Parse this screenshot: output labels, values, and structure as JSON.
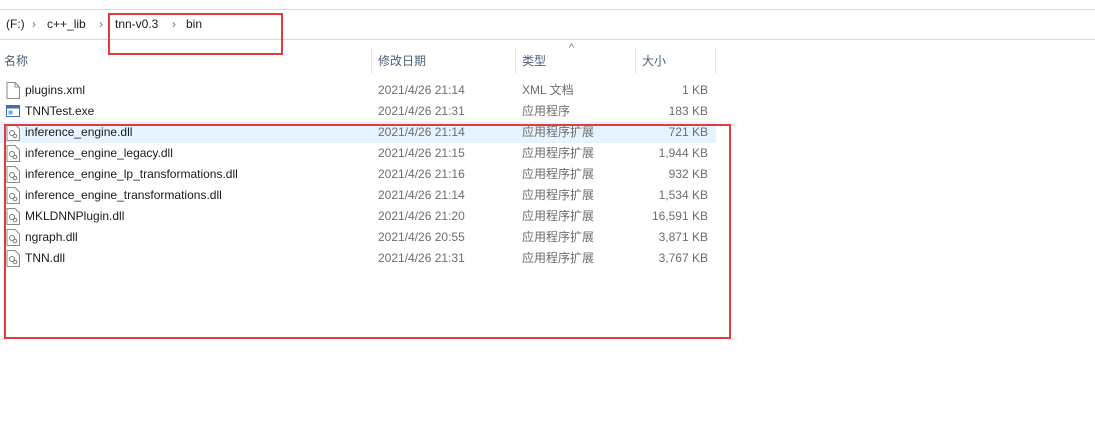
{
  "breadcrumb": {
    "items": [
      "(F:)",
      "c++_lib",
      "tnn-v0.3",
      "bin"
    ],
    "separator": ">"
  },
  "columns": {
    "name": "名称",
    "date": "修改日期",
    "type": "类型",
    "size": "大小"
  },
  "files": [
    {
      "name": "plugins.xml",
      "date": "2021/4/26 21:14",
      "type": "XML 文档",
      "size": "1 KB",
      "icon": "xml-file-icon"
    },
    {
      "name": "TNNTest.exe",
      "date": "2021/4/26 21:31",
      "type": "应用程序",
      "size": "183 KB",
      "icon": "exe-file-icon"
    },
    {
      "name": "inference_engine.dll",
      "date": "2021/4/26 21:14",
      "type": "应用程序扩展",
      "size": "721 KB",
      "icon": "dll-file-icon"
    },
    {
      "name": "inference_engine_legacy.dll",
      "date": "2021/4/26 21:15",
      "type": "应用程序扩展",
      "size": "1,944 KB",
      "icon": "dll-file-icon"
    },
    {
      "name": "inference_engine_lp_transformations.dll",
      "date": "2021/4/26 21:16",
      "type": "应用程序扩展",
      "size": "932 KB",
      "icon": "dll-file-icon"
    },
    {
      "name": "inference_engine_transformations.dll",
      "date": "2021/4/26 21:14",
      "type": "应用程序扩展",
      "size": "1,534 KB",
      "icon": "dll-file-icon"
    },
    {
      "name": "MKLDNNPlugin.dll",
      "date": "2021/4/26 21:20",
      "type": "应用程序扩展",
      "size": "16,591 KB",
      "icon": "dll-file-icon"
    },
    {
      "name": "ngraph.dll",
      "date": "2021/4/26 20:55",
      "type": "应用程序扩展",
      "size": "3,871 KB",
      "icon": "dll-file-icon"
    },
    {
      "name": "TNN.dll",
      "date": "2021/4/26 21:31",
      "type": "应用程序扩展",
      "size": "3,767 KB",
      "icon": "dll-file-icon"
    }
  ],
  "selected_row": "inference_engine.dll",
  "colors": {
    "highlight_box": "#e5393b",
    "selection": "#e5f3ff",
    "header_text": "#4c607a"
  }
}
